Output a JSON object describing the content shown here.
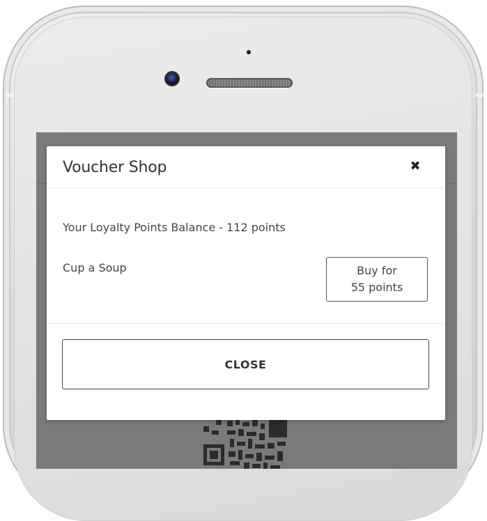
{
  "modal": {
    "title": "Voucher Shop",
    "close_icon": "close-icon",
    "balance_text": "Your Loyalty Points Balance - 112 points",
    "items": [
      {
        "name": "Cup a Soup",
        "buy_line1": "Buy for",
        "buy_line2": "55 points"
      }
    ],
    "close_button_label": "CLOSE"
  },
  "colors": {
    "screen_overlay": "#7a7a7a",
    "modal_bg": "#ffffff",
    "text": "#444444"
  }
}
